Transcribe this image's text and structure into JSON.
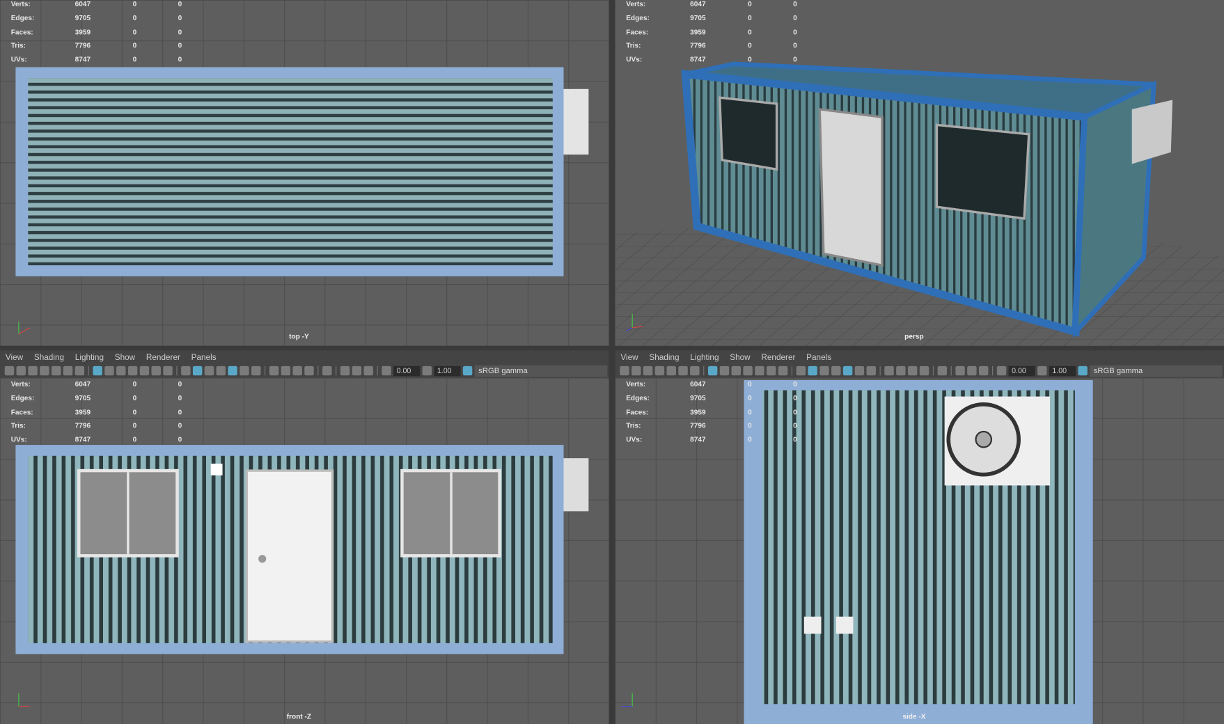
{
  "hud": {
    "rows": [
      {
        "label": "Verts:",
        "value": "6047",
        "sel1": "0",
        "sel2": "0"
      },
      {
        "label": "Edges:",
        "value": "9705",
        "sel1": "0",
        "sel2": "0"
      },
      {
        "label": "Faces:",
        "value": "3959",
        "sel1": "0",
        "sel2": "0"
      },
      {
        "label": "Tris:",
        "value": "7796",
        "sel1": "0",
        "sel2": "0"
      },
      {
        "label": "UVs:",
        "value": "8747",
        "sel1": "0",
        "sel2": "0"
      }
    ]
  },
  "menu": {
    "view": "View",
    "shading": "Shading",
    "lighting": "Lighting",
    "show": "Show",
    "renderer": "Renderer",
    "panels": "Panels"
  },
  "toolbar": {
    "exposure": "0.00",
    "gamma": "1.00",
    "color_space": "sRGB gamma"
  },
  "cameras": {
    "top": "top -Y",
    "persp": "persp",
    "front": "front -Z",
    "side": "side -X"
  },
  "colors": {
    "frame": "#7fa6d4",
    "wall": "#5d8a90",
    "persp_frame": "#2f6fb8",
    "active_icon": "#5aa8c8"
  }
}
